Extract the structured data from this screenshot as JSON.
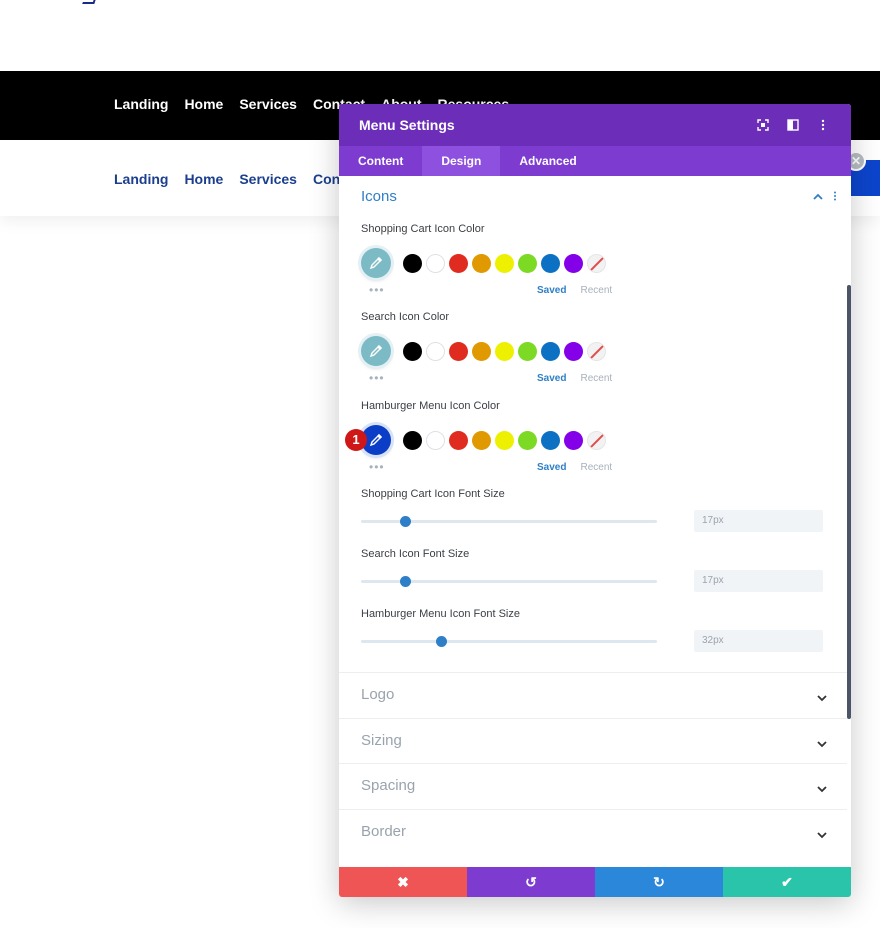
{
  "nav_top": {
    "items": [
      "Landing",
      "Home",
      "Services",
      "Contact",
      "About",
      "Resources"
    ]
  },
  "nav_bottom": {
    "items": [
      "Landing",
      "Home",
      "Services",
      "Contact"
    ]
  },
  "modal": {
    "title": "Menu Settings",
    "tabs": [
      {
        "label": "Content",
        "active": false
      },
      {
        "label": "Design",
        "active": true
      },
      {
        "label": "Advanced",
        "active": false
      }
    ],
    "section": {
      "title": "Icons",
      "color_fields": [
        {
          "label": "Shopping Cart Icon Color",
          "current_color": "#7cbbc6",
          "saved_label": "Saved",
          "recent_label": "Recent"
        },
        {
          "label": "Search Icon Color",
          "current_color": "#7cbbc6",
          "saved_label": "Saved",
          "recent_label": "Recent"
        },
        {
          "label": "Hamburger Menu Icon Color",
          "current_color": "#0c3dc7",
          "saved_label": "Saved",
          "recent_label": "Recent",
          "badge": "1"
        }
      ],
      "swatches": [
        "#000000",
        "#ffffff",
        "#e02b20",
        "#e09900",
        "#edf000",
        "#7cda24",
        "#0c71c3",
        "#8300e9",
        "none"
      ],
      "sliders": [
        {
          "label": "Shopping Cart Icon Font Size",
          "value": "17px",
          "fraction": 0.15
        },
        {
          "label": "Search Icon Font Size",
          "value": "17px",
          "fraction": 0.15
        },
        {
          "label": "Hamburger Menu Icon Font Size",
          "value": "32px",
          "fraction": 0.27
        }
      ]
    },
    "collapsed_sections": [
      "Logo",
      "Sizing",
      "Spacing",
      "Border"
    ],
    "footer": {
      "discard": "✖",
      "undo": "↺",
      "redo": "↻",
      "save": "✔"
    }
  },
  "colors": {
    "header_purple": "#6c2eb9",
    "tabs_purple": "#7d3bd0",
    "accent_blue": "#2e7fc7",
    "discard_red": "#ef5555",
    "redo_blue": "#2b87da",
    "save_green": "#29c4a9"
  }
}
